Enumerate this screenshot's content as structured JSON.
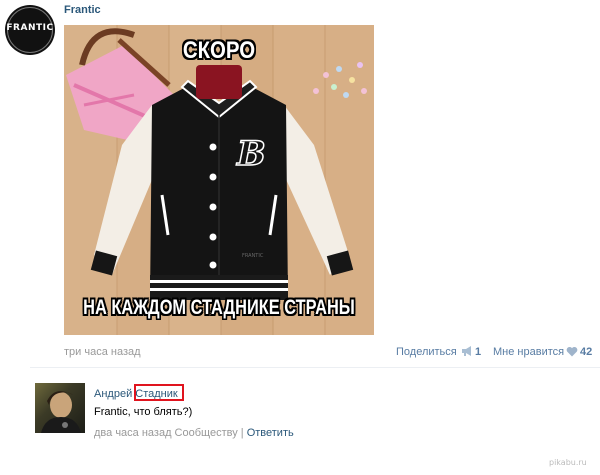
{
  "post": {
    "group_name": "Frantic",
    "avatar_logo": "FRANTIC",
    "image": {
      "top_caption": "СКОРО",
      "bottom_caption": "НА КАЖДОМ СТАДНИКЕ СТРАНЫ",
      "jacket_letter": "B",
      "jacket_patch": "FRANTIC"
    },
    "time": "три часа назад",
    "share_label": "Поделиться",
    "share_count": "1",
    "like_label": "Мне нравится",
    "like_count": "42"
  },
  "comment": {
    "author_first": "Андрей",
    "author_last": "Стадник",
    "text": "Frantic, что блять?)",
    "time": "два часа назад",
    "context": "Сообществу",
    "separator": "|",
    "reply_label": "Ответить"
  },
  "watermark": "pikabu.ru",
  "colors": {
    "link": "#2b587a",
    "muted": "#999999",
    "highlight": "#e0141e"
  }
}
